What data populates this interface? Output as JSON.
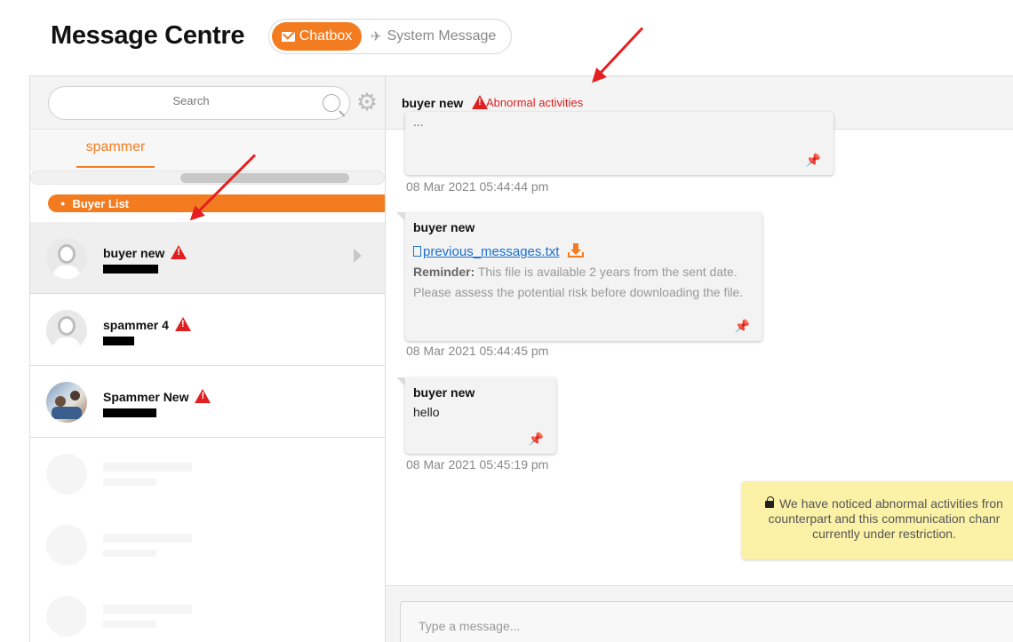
{
  "header": {
    "title": "Message Centre",
    "tabs": [
      {
        "label": "Chatbox",
        "icon": "mail-icon",
        "active": true
      },
      {
        "label": "System Message",
        "icon": "paper-plane-icon",
        "active": false
      }
    ],
    "accent_color": "#f47c20"
  },
  "sidebar": {
    "search_placeholder": "Search",
    "filter_tabs": [
      {
        "label": "spammer",
        "active": true
      }
    ],
    "group_label": "Buyer List",
    "contacts": [
      {
        "name": "buyer new",
        "warning": true,
        "selected": true,
        "avatar": "default-avatar-icon"
      },
      {
        "name": "spammer 4",
        "warning": true,
        "selected": false,
        "avatar": "default-avatar-icon"
      },
      {
        "name": "Spammer New",
        "warning": true,
        "selected": false,
        "avatar": "photo-avatar"
      }
    ]
  },
  "chat": {
    "contact_name": "buyer new",
    "status": "Abnormal activities",
    "messages": [
      {
        "sender": "",
        "text": "...",
        "time": "08 Mar 2021 05:44:44 pm"
      },
      {
        "sender": "buyer new",
        "file_name": "previous_messages.txt",
        "reminder_label": "Reminder:",
        "reminder_line1": "This file is available 2 years from the sent date.",
        "reminder_line2": "Please assess the potential risk before downloading the file.",
        "time": "08 Mar 2021 05:44:45 pm"
      },
      {
        "sender": "buyer new",
        "text": "hello",
        "time": "08 Mar 2021 05:45:19 pm"
      }
    ],
    "notice": {
      "line1": "We have noticed abnormal activities fron",
      "line2": "counterpart and this communication chanr",
      "line3": "currently under restriction."
    },
    "compose_placeholder": "Type a message..."
  },
  "colors": {
    "warning": "#e02020",
    "notice_bg": "#fbf2a8",
    "link": "#1a6fd0"
  }
}
